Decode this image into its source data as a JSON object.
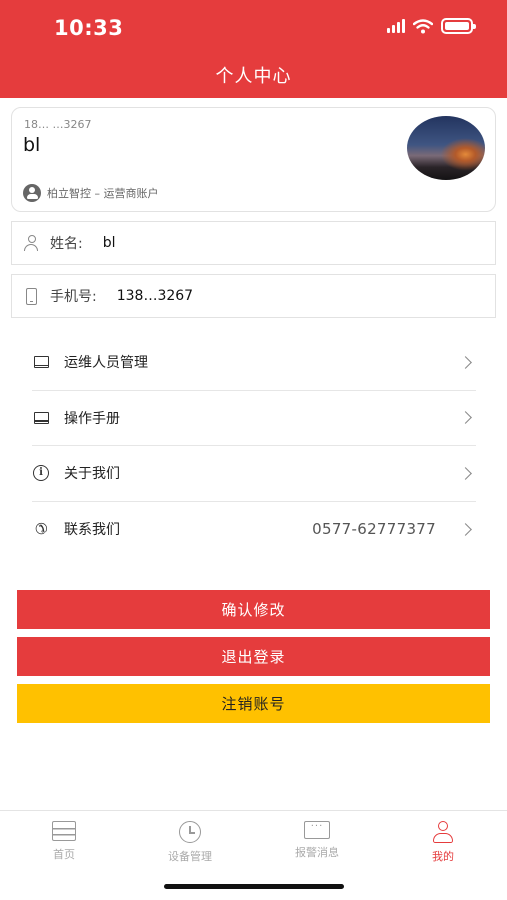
{
  "status_bar": {
    "time": "10:33"
  },
  "header": {
    "title": "个人中心"
  },
  "profile": {
    "account_id": "18…  …3267",
    "username": "bl",
    "organization": "柏立智控 – 运营商账户",
    "avatar_icon": "avatar-city-night"
  },
  "fields": {
    "name": {
      "label": "姓名:",
      "value": "bl",
      "icon": "person-icon"
    },
    "phone": {
      "label": "手机号:",
      "value": "138…3267",
      "icon": "phone-icon"
    }
  },
  "menu": [
    {
      "label": "运维人员管理",
      "icon": "book-icon",
      "value": ""
    },
    {
      "label": "操作手册",
      "icon": "book-icon",
      "value": ""
    },
    {
      "label": "关于我们",
      "icon": "info-icon",
      "value": ""
    },
    {
      "label": "联系我们",
      "icon": "phone-icon",
      "value": "0577-62777377"
    }
  ],
  "buttons": {
    "confirm": "确认修改",
    "logout": "退出登录",
    "delete_account": "注销账号"
  },
  "tabbar": [
    {
      "label": "首页",
      "icon": "home-icon",
      "active": false
    },
    {
      "label": "设备管理",
      "icon": "clock-icon",
      "active": false
    },
    {
      "label": "报警消息",
      "icon": "message-icon",
      "active": false
    },
    {
      "label": "我的",
      "icon": "user-icon",
      "active": true
    }
  ],
  "colors": {
    "primary": "#e53c3d",
    "warning": "#ffc100",
    "inactive": "#aaaaaa"
  }
}
